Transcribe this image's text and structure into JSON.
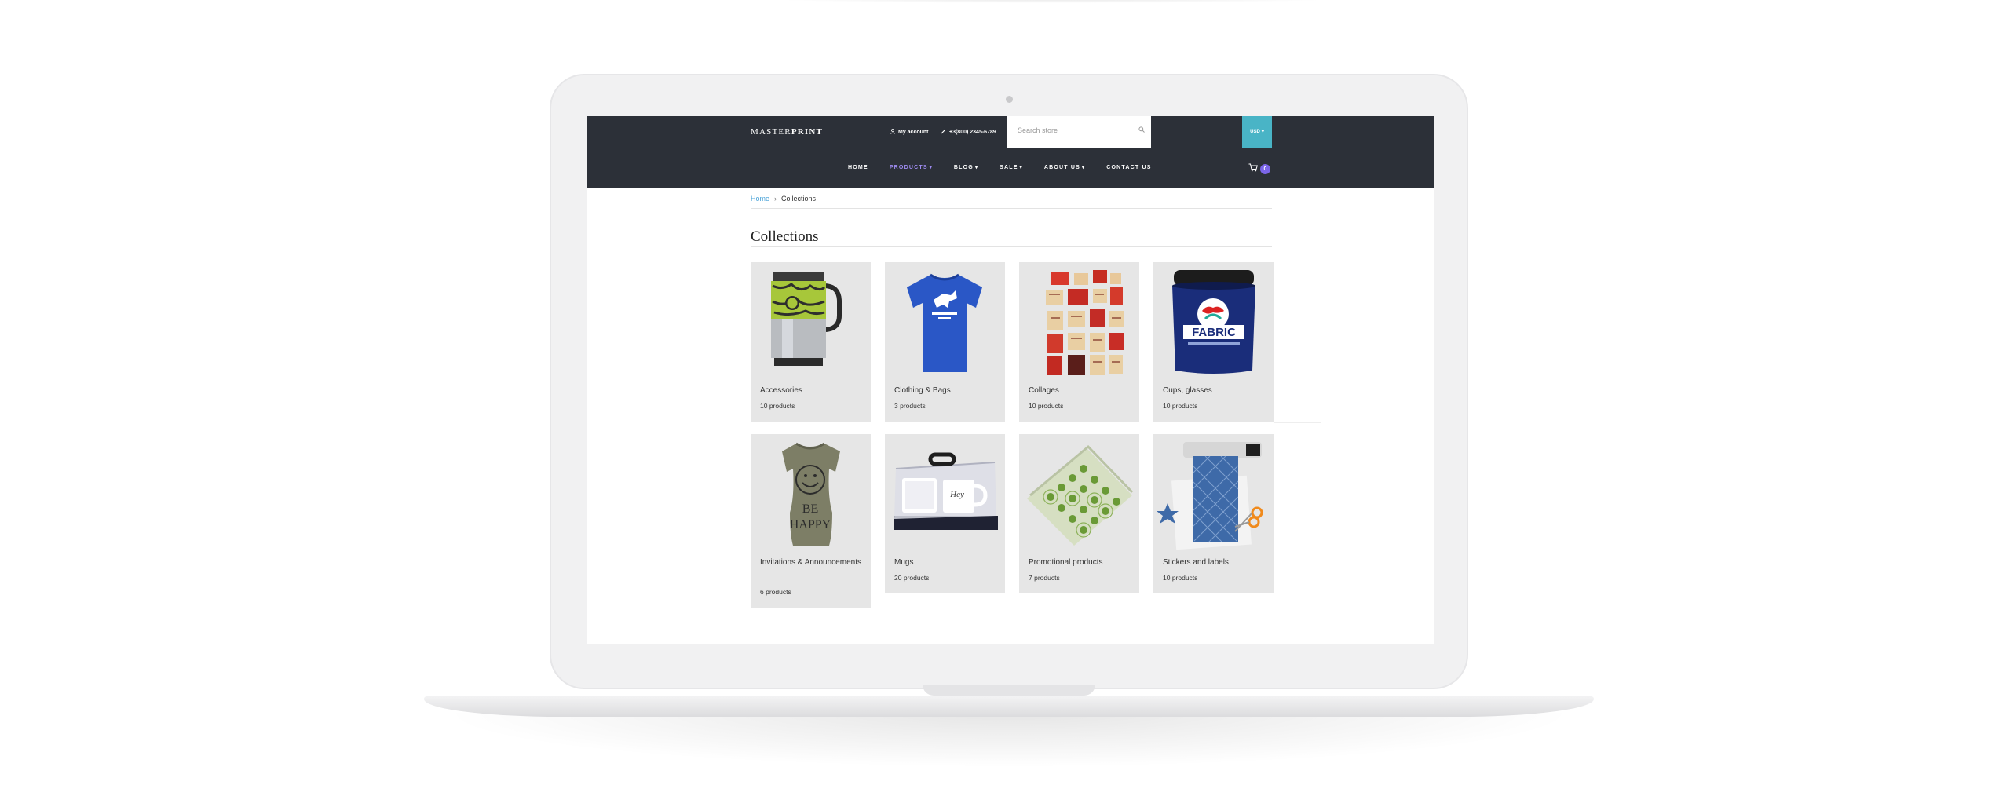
{
  "header": {
    "logo_light": "MASTER",
    "logo_bold": "PRINT",
    "account_label": "My account",
    "phone": "+3(800) 2345-6789",
    "search_placeholder": "Search store",
    "currency": "USD"
  },
  "nav": {
    "items": [
      {
        "label": "HOME",
        "dropdown": false
      },
      {
        "label": "PRODUCTS",
        "dropdown": true,
        "active": true
      },
      {
        "label": "BLOG",
        "dropdown": true
      },
      {
        "label": "SALE",
        "dropdown": true
      },
      {
        "label": "ABOUT US",
        "dropdown": true
      },
      {
        "label": "CONTACT US",
        "dropdown": false
      }
    ],
    "cart_count": "0"
  },
  "breadcrumb": {
    "home": "Home",
    "current": "Collections"
  },
  "page": {
    "title": "Collections"
  },
  "collections": [
    {
      "name": "Accessories",
      "count": "10 products",
      "icon": "travel-mug-icon"
    },
    {
      "name": "Clothing & Bags",
      "count": "3 products",
      "icon": "blue-tshirt-icon"
    },
    {
      "name": "Collages",
      "count": "10 products",
      "icon": "collage-cards-icon"
    },
    {
      "name": "Cups, glasses",
      "count": "10 products",
      "icon": "paint-jar-icon"
    },
    {
      "name": "Invitations & Announcements",
      "count": "6 products",
      "icon": "happy-tshirt-icon"
    },
    {
      "name": "Mugs",
      "count": "20 products",
      "icon": "mug-box-icon"
    },
    {
      "name": "Promotional products",
      "count": "7 products",
      "icon": "sticker-sheet-icon"
    },
    {
      "name": "Stickers and labels",
      "count": "10 products",
      "icon": "vinyl-cutter-icon"
    }
  ],
  "colors": {
    "header_bg": "#2c3038",
    "accent_purple": "#7b65e8",
    "currency_bg": "#49b4c6",
    "link_blue": "#4aa3d8"
  }
}
